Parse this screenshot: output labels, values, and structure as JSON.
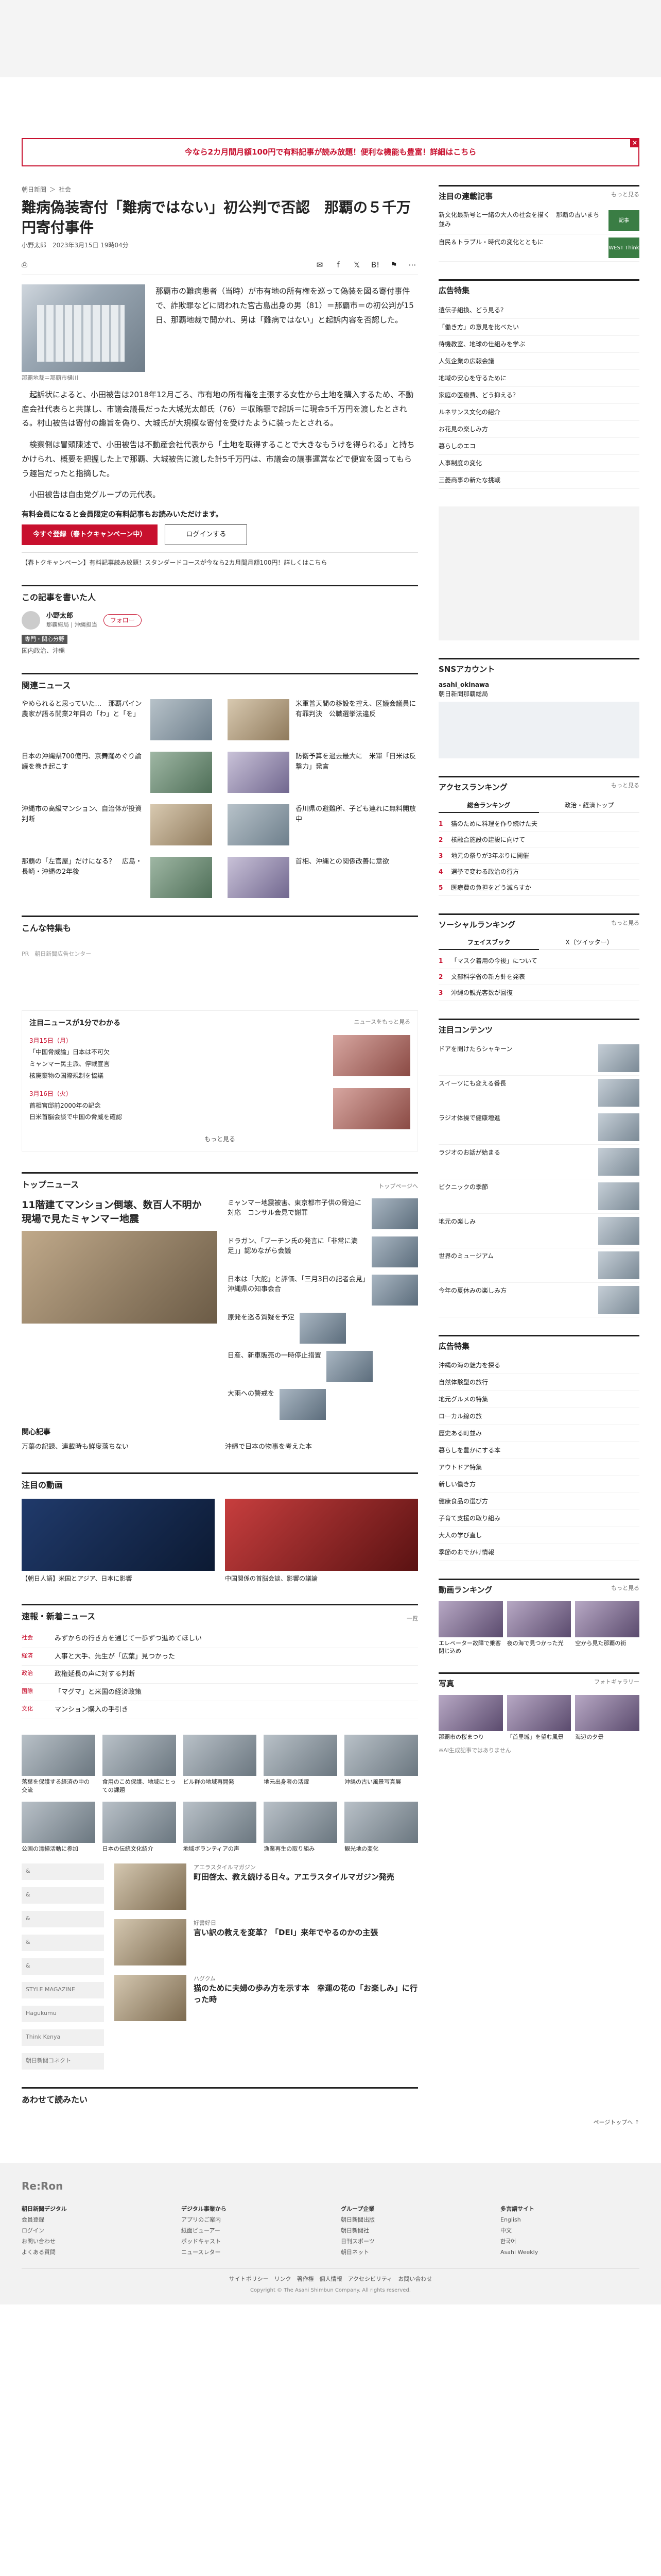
{
  "promo": {
    "text": "今なら2カ月間月額100円で有料記事が読み放題！便利な機能も豊富！詳細はこちら",
    "close": "×"
  },
  "breadcrumb": [
    "朝日新聞",
    "社会"
  ],
  "article": {
    "title": "難病偽装寄付「難病ではない」初公判で否認　那覇の５千万円寄付事件",
    "byline": "小野太郎　2023年3月15日 19時04分",
    "caption": "那覇地裁＝那覇市樋川",
    "paras": [
      "那覇市の難病患者（当時）が市有地の所有権を巡って偽装を図る寄付事件で、詐欺罪などに問われた宮古島出身の男（81）＝那覇市＝の初公判が15日、那覇地裁で開かれ、男は「難病ではない」と起訴内容を否認した。",
      "起訴状によると、小田被告は2018年12月ごろ、市有地の所有権を主張する女性から土地を購入するため、不動産会社代表らと共謀し、市議会議長だった大城光太郎氏（76）＝収賄罪で起訴＝に現金5千万円を渡したとされる。村山被告は寄付の趣旨を偽り、大城氏が大規模な寄付を受けたように装ったとされる。",
      "検察側は冒頭陳述で、小田被告は不動産会社代表から「土地を取得することで大きなもうけを得られる」と持ちかけられ、概要を把握した上で那覇、大城被告に渡した計5千万円は、市議会の議事運営などで便宜を図ってもらう趣旨だったと指摘した。",
      "小田被告は自由党グループの元代表。"
    ],
    "paywall": "有料会員になると会員限定の有料記事もお読みいただけます。",
    "btn_subscribe": "今すぐ登録（春トクキャンペーン中）",
    "btn_login": "ログインする",
    "campaign": "【春トクキャンペーン】有料記事読み放題！スタンダードコースが今なら2カ月間月額100円！詳しくはこちら"
  },
  "author_sec": {
    "heading": "この記事を書いた人",
    "name": "小野太郎",
    "role": "那覇総局 | 沖縄担当",
    "follow": "フォロー",
    "tag": "専門・関心分野",
    "area": "国内政治、沖縄"
  },
  "related": {
    "heading": "関連ニュース",
    "items": [
      "やめられると思っていた…　那覇パイン農家が語る開業2年目の「わ」と「を」",
      "米軍普天間の移設を控え、区議会議員に有罪判決　公職選挙法違反",
      "日本の沖縄県700億円、京舞踊めぐり論議を巻き起こす",
      "防衛予算を過去最大に　米軍「日米は反撃力」発言",
      "沖縄市の高級マンション、自治体が投資判断",
      "香川県の避難所、子ども連れに無料開放中",
      "那覇の「左官屋」だけになる？　広島・長崎・沖縄の2年後",
      "首相、沖縄との関係改善に意欲"
    ],
    "recommend": "こんな特集も"
  },
  "ad_note": "PR　朝日新聞広告センター",
  "pick": {
    "heading": "注目ニュースが1分でわかる",
    "link": "ニュースをもっと見る",
    "date1": "3月15日（月）",
    "items1": [
      "「中国脅威論」日本は不可欠",
      "ミャンマー民主派、停戦宣言",
      "核廃棄物の国際規制を協議"
    ],
    "date2": "3月16日（火）",
    "items2": [
      "首相官邸前2000年の記念",
      "日米首脳会談で中国の脅威を確認"
    ],
    "more": "もっと見る"
  },
  "top": {
    "heading": "トップニュース",
    "link": "トップページへ",
    "lead": "11階建てマンション倒壊、数百人不明か　現場で見たミャンマー地震",
    "items": [
      "ミャンマー地震被害、東京都市子供の脅迫に対応　コンサル会見で謝罪",
      "ドラガン、「ブーチン氏の発言に「非常に満足」」認めながら会議",
      "日本は「大舵」と評価、「三月3日の記者会見」沖縄県の知事会合",
      "原発を巡る質疑を予定",
      "日産、新車販売の一時停止措置",
      "大雨への警戒を"
    ],
    "sub": "関心記事",
    "sub_items": [
      "万葉の記録、連載時も鮮度落ちない",
      "沖縄で日本の物事を考えた本"
    ]
  },
  "video": {
    "heading": "注目の動画",
    "items": [
      "【朝日人語】米国とアジア、日本に影響",
      "中国関係の首脳会談、影響の議論"
    ]
  },
  "ranking": {
    "heading": "速報・新着ニュース",
    "link": "一覧",
    "items": [
      {
        "label": "社会",
        "text": "みずからの行き方を通じて一歩ずつ進めてほしい"
      },
      {
        "label": "経済",
        "text": "人事と大手、先生が「広葉」見つかった"
      },
      {
        "label": "政治",
        "text": "政権延長の声に対する判断"
      },
      {
        "label": "国際",
        "text": "「マグマ」と米国の経済政策"
      },
      {
        "label": "文化",
        "text": "マンション購入の手引き"
      }
    ]
  },
  "grid": [
    "落葉を保護する経済の中の交流",
    "食用のこめ保護、地域にとっての課題",
    "ビル群の地域再開発",
    "地元出身者の活躍",
    "沖縄の古い風景写真展",
    "公園の清掃活動に参加",
    "日本の伝統文化紹介",
    "地域ボランティアの声",
    "漁業再生の取り組み",
    "観光地の変化"
  ],
  "brands": [
    "&",
    "&",
    "&",
    "&",
    "&",
    "STYLE MAGAZINE",
    "Hagukumu",
    "Think Kenya",
    "朝日新聞コネクト"
  ],
  "brand_arts": [
    {
      "kicker": "アエラスタイルマガジン",
      "title": "町田啓太、教え続ける日々。アエラスタイルマガジン発売"
    },
    {
      "kicker": "好書好日",
      "title": "言い訳の教えを変革？「DEI」来年でやるのかの主張"
    },
    {
      "kicker": "ハグクム",
      "title": "猫のために夫婦の歩み方を示す本　幸運の花の「お楽しみ」に行った時"
    }
  ],
  "more_read": "あわせて読みたい",
  "side": {
    "attention": {
      "heading": "注目の連載記事",
      "link": "もっと見る",
      "items": [
        "新文化最新号と一緒の大人の社会を描く　那覇の古いまち並み",
        "自民＆トラブル・時代の変化とともに"
      ]
    },
    "think": "WEST Think",
    "fake": {
      "heading": "広告特集",
      "items": [
        "遺伝子組換、どう見る？",
        "「働き方」の意見を比べたい",
        "待機教室、地球の仕組みを学ぶ",
        "人気企業の広報会議",
        "地域の安心を守るために",
        "家庭の医療費、どう抑える？",
        "ルネサンス文化の紹介",
        "お花見の楽しみ方",
        "暮らしのエコ",
        "人事制度の変化",
        "三菱商事の新たな挑戦"
      ]
    },
    "sns": {
      "heading": "SNSアカウント",
      "name": "asahi_okinawa",
      "desc": "朝日新聞那覇総局"
    },
    "access": {
      "heading": "アクセスランキング",
      "link": "もっと見る",
      "tabs": [
        "総合ランキング",
        "政治・経済トップ"
      ],
      "items": [
        "猫のために料理を作り続けた夫",
        "核融合施設の建設に向けて",
        "地元の祭りが3年ぶりに開催",
        "選挙で変わる政治の行方",
        "医療費の負担をどう減らすか"
      ]
    },
    "social": {
      "heading": "ソーシャルランキング",
      "link": "もっと見る",
      "tabs": [
        "フェイスブック",
        "X（ツイッター）"
      ],
      "items": [
        "「マスク着用の今後」について",
        "文部科学省の新方針を発表",
        "沖縄の観光客数が回復"
      ]
    },
    "contents": {
      "heading": "注目コンテンツ",
      "items": [
        "ドアを開けたらシャキーン",
        "スイーツにも変える番長",
        "ラジオ体操で健康増進",
        "ラジオのお話が始まる",
        "ピクニックの季節",
        "地元の楽しみ",
        "世界のミュージアム",
        "今年の夏休みの楽しみ方"
      ]
    },
    "sponsor": {
      "heading": "広告特集",
      "items": [
        "沖縄の海の魅力を探る",
        "自然体験型の旅行",
        "地元グルメの特集",
        "ローカル線の旅",
        "歴史ある町並み",
        "暮らしを豊かにする本",
        "アウトドア特集",
        "新しい働き方",
        "健康食品の選び方",
        "子育て支援の取り組み",
        "大人の学び直し",
        "季節のおでかけ情報"
      ]
    },
    "movies": {
      "heading": "動画ランキング",
      "link": "もっと見る",
      "items": [
        "エレベーター故障で乗客閉じ込め",
        "夜の海で見つかった光",
        "空から見た那覇の街"
      ]
    },
    "photos": {
      "heading": "写真",
      "link": "フォトギャラリー",
      "items": [
        "那覇市の桜まつり",
        "「首里城」を望む風景",
        "海辺の夕景"
      ]
    },
    "note": "※AI生成記事ではありません"
  },
  "footer": {
    "brand": "Re:Ron",
    "cols": [
      {
        "h": "朝日新聞デジタル",
        "items": [
          "会員登録",
          "ログイン",
          "お問い合わせ",
          "よくある質問"
        ]
      },
      {
        "h": "デジタル事業から",
        "items": [
          "アプリのご案内",
          "紙面ビューアー",
          "ポッドキャスト",
          "ニュースレター"
        ]
      },
      {
        "h": "グループ企業",
        "items": [
          "朝日新聞出版",
          "朝日新聞社",
          "日刊スポーツ",
          "朝日ネット"
        ]
      },
      {
        "h": "多言語サイト",
        "items": [
          "English",
          "中文",
          "한국어",
          "Asahi Weekly"
        ]
      }
    ],
    "links": "サイトポリシー　リンク　著作権　個人情報　アクセシビリティ　お問い合わせ",
    "copy": "Copyright © The Asahi Shimbun Company. All rights reserved.",
    "pagetop": "ページトップへ ↑"
  }
}
